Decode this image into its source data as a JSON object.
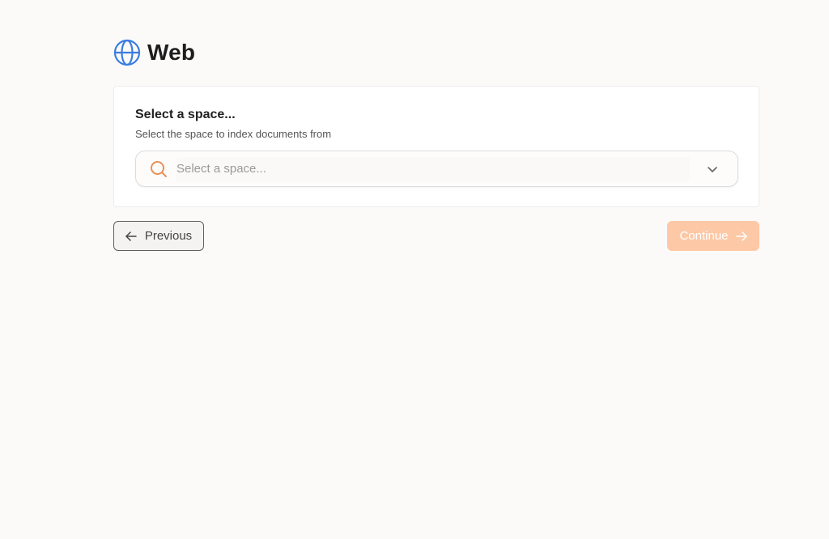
{
  "header": {
    "title": "Web",
    "icon": "globe-icon",
    "icon_color": "#3b7de0"
  },
  "space_card": {
    "title": "Select a space...",
    "subtitle": "Select the space to index documents from",
    "select": {
      "placeholder": "Select a space...",
      "value": "",
      "search_icon": "search-icon",
      "search_icon_color": "#e8915a",
      "dropdown_icon": "chevron-down-icon"
    }
  },
  "footer": {
    "previous_label": "Previous",
    "previous_icon": "arrow-left-icon",
    "continue_label": "Continue",
    "continue_icon": "arrow-right-icon",
    "continue_color": "#fdc8a6",
    "continue_disabled": true
  }
}
